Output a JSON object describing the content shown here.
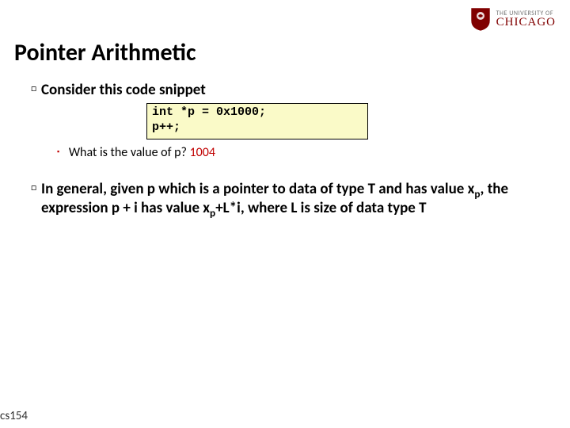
{
  "logo": {
    "top": "THE UNIVERSITY OF",
    "bottom": "CHICAGO"
  },
  "title": "Pointer Arithmetic",
  "bullet1": "Consider this code snippet",
  "code": "int *p = 0x1000;\np++;",
  "sub_q": "What is the value of p? ",
  "sub_a": "1004",
  "bullet2_pre": "In general, given p which is a pointer to data of type T and has value x",
  "bullet2_sub1": "p",
  "bullet2_mid": ", the expression p + i has value x",
  "bullet2_sub2": "p",
  "bullet2_post": "+L*i, where L is size of data type T",
  "footer": "cs154"
}
